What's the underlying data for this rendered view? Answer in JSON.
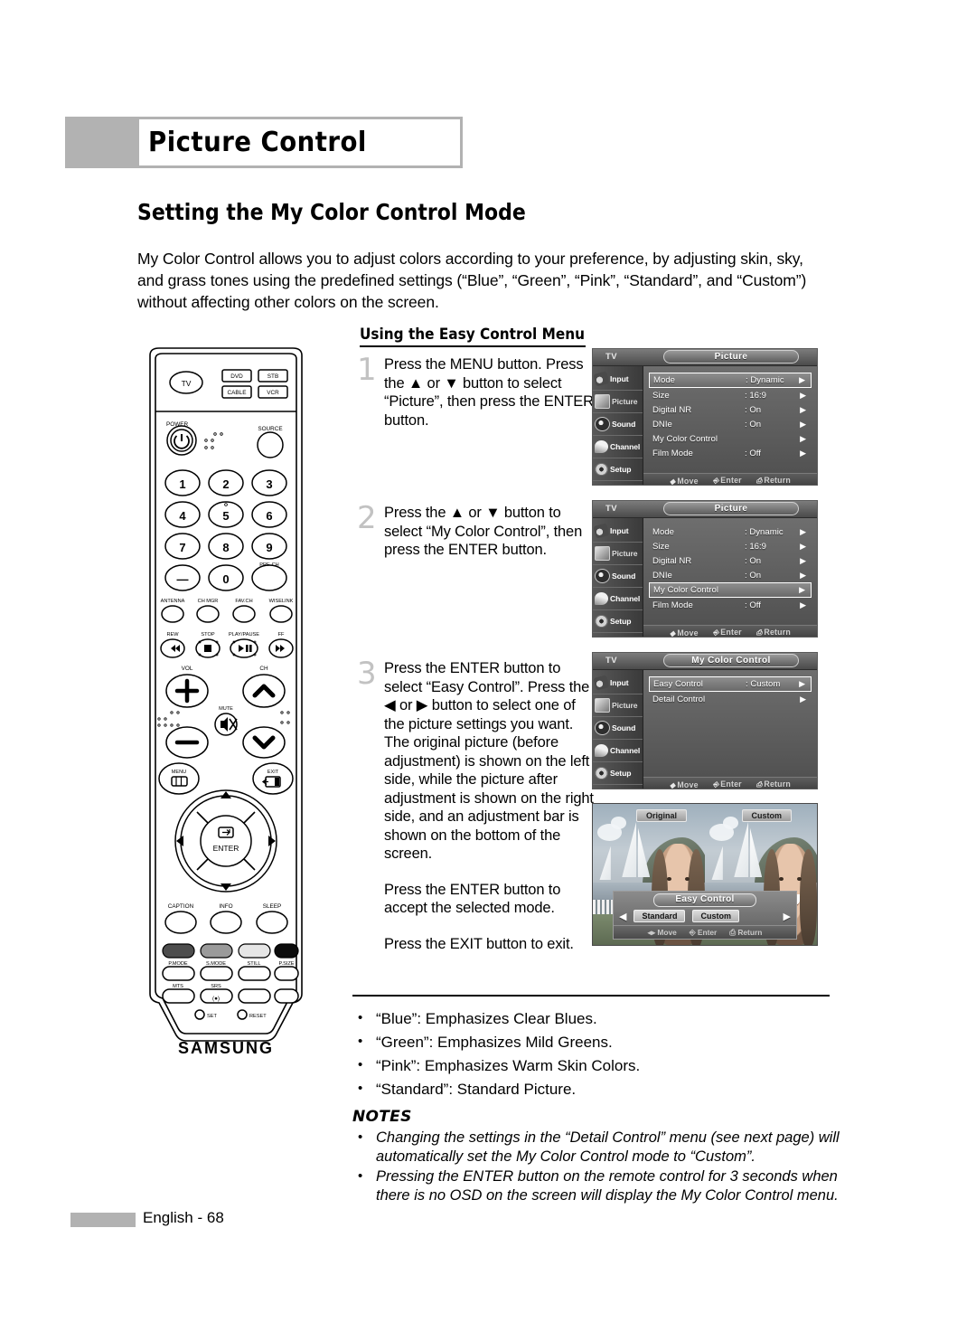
{
  "header": {
    "title": "Picture Control"
  },
  "section": {
    "title": "Setting the My Color Control Mode",
    "intro": "My Color Control allows you to adjust colors according to your preference, by adjusting skin, sky, and grass tones using the predefined settings (“Blue”, “Green”, “Pink”, “Standard”, and “Custom”) without affecting other colors on the screen.",
    "subsection_title": "Using the Easy Control Menu"
  },
  "steps": [
    {
      "number": "1",
      "lines": [
        "Press the MENU button. Press the ▲ or ▼ button to select “Picture”, then press the ENTER button."
      ]
    },
    {
      "number": "2",
      "lines": [
        "Press the ▲ or ▼ button to select “My Color Control”, then press the ENTER button."
      ]
    },
    {
      "number": "3",
      "lines": [
        "Press the ENTER button to select “Easy Control”. Press the ◀ or ▶ button to select one of the picture settings you want. The original picture (before adjustment) is shown on the left side, while the picture after adjustment is shown on the right side, and an adjustment bar is shown on the bottom of the screen.",
        "Press the ENTER button to accept the selected mode.",
        "Press the EXIT button to exit."
      ]
    }
  ],
  "osd_common": {
    "tv_label": "TV",
    "sidebar": [
      {
        "label": "Input",
        "icon": "antenna-input-icon"
      },
      {
        "label": "Picture",
        "icon": "picture-tv-icon"
      },
      {
        "label": "Sound",
        "icon": "speaker-sound-icon"
      },
      {
        "label": "Channel",
        "icon": "satellite-channel-icon"
      },
      {
        "label": "Setup",
        "icon": "gear-setup-icon"
      }
    ],
    "footer": {
      "move": "Move",
      "enter": "Enter",
      "return": "Return"
    }
  },
  "osd_screens": [
    {
      "id": "osd-picture-1",
      "title": "Picture",
      "active_sidebar": "Picture",
      "rows": [
        {
          "label": "Mode",
          "value": ": Dynamic",
          "arrow": "▶",
          "selected": true
        },
        {
          "label": "Size",
          "value": ": 16:9",
          "arrow": "▶",
          "selected": false
        },
        {
          "label": "Digital NR",
          "value": ": On",
          "arrow": "▶",
          "selected": false
        },
        {
          "label": "DNIe",
          "value": ": On",
          "arrow": "▶",
          "selected": false
        },
        {
          "label": "My Color Control",
          "value": "",
          "arrow": "▶",
          "selected": false
        },
        {
          "label": "Film Mode",
          "value": ": Off",
          "arrow": "▶",
          "selected": false
        }
      ]
    },
    {
      "id": "osd-picture-2",
      "title": "Picture",
      "active_sidebar": "Picture",
      "rows": [
        {
          "label": "Mode",
          "value": ": Dynamic",
          "arrow": "▶",
          "selected": false
        },
        {
          "label": "Size",
          "value": ": 16:9",
          "arrow": "▶",
          "selected": false
        },
        {
          "label": "Digital NR",
          "value": ": On",
          "arrow": "▶",
          "selected": false
        },
        {
          "label": "DNIe",
          "value": ": On",
          "arrow": "▶",
          "selected": false
        },
        {
          "label": "My Color Control",
          "value": "",
          "arrow": "▶",
          "selected": true
        },
        {
          "label": "Film Mode",
          "value": ": Off",
          "arrow": "▶",
          "selected": false
        }
      ]
    },
    {
      "id": "osd-my-color-control",
      "title": "My Color Control",
      "active_sidebar": "Picture",
      "rows": [
        {
          "label": "Easy Control",
          "value": ": Custom",
          "arrow": "▶",
          "selected": true
        },
        {
          "label": "Detail Control",
          "value": "",
          "arrow": "▶",
          "selected": false
        }
      ]
    }
  ],
  "preview": {
    "left_tag": "Original",
    "right_tag": "Custom",
    "osd_title": "Easy Control",
    "chips": [
      "Standard",
      "Custom"
    ],
    "left_caret": "◀",
    "right_caret": "▶",
    "footer": {
      "move": "Move",
      "enter": "Enter",
      "return": "Return"
    }
  },
  "bullets": [
    "“Blue”: Emphasizes Clear Blues.",
    "“Green”: Emphasizes Mild Greens.",
    "“Pink”: Emphasizes Warm Skin Colors.",
    "“Standard”: Standard Picture."
  ],
  "notes": {
    "title": "NOTES",
    "items": [
      "Changing the settings in the “Detail Control” menu (see next page) will automatically set the My Color Control mode to “Custom”.",
      "Pressing the ENTER button on the remote control for 3 seconds when there is no OSD on the screen will display the My Color Control menu."
    ]
  },
  "footer": {
    "page_label": "English - 68"
  },
  "remote": {
    "brand": "SAMSUNG",
    "device_buttons": [
      "TV",
      "DVD",
      "STB",
      "CABLE",
      "VCR"
    ],
    "power_label": "POWER",
    "source_label": "SOURCE",
    "numbers": [
      "1",
      "2",
      "3",
      "4",
      "5",
      "6",
      "7",
      "8",
      "9",
      "—",
      "0"
    ],
    "prech_label": "PRE-CH",
    "function_row": [
      "ANTENNA",
      "CH MGR",
      "FAV.CH",
      "WISELINK"
    ],
    "transport_row": [
      "REW",
      "STOP",
      "PLAY/PAUSE",
      "FF"
    ],
    "vol_label": "VOL",
    "ch_label": "CH",
    "mute_label": "MUTE",
    "menu_label": "MENU",
    "exit_label": "EXIT",
    "enter_label": "ENTER",
    "util_row": [
      "CAPTION",
      "INFO",
      "SLEEP"
    ],
    "color_row": [
      "P.MODE",
      "S.MODE",
      "STILL",
      "P.SIZE"
    ],
    "audio_row": [
      "MTS",
      "SRS"
    ],
    "set_label": "SET",
    "reset_label": "RESET"
  },
  "colors": {
    "header_gray": "#b2b2b2",
    "step_number_gray": "#c2c2c2",
    "osd_dark": "#4e4e4e"
  }
}
